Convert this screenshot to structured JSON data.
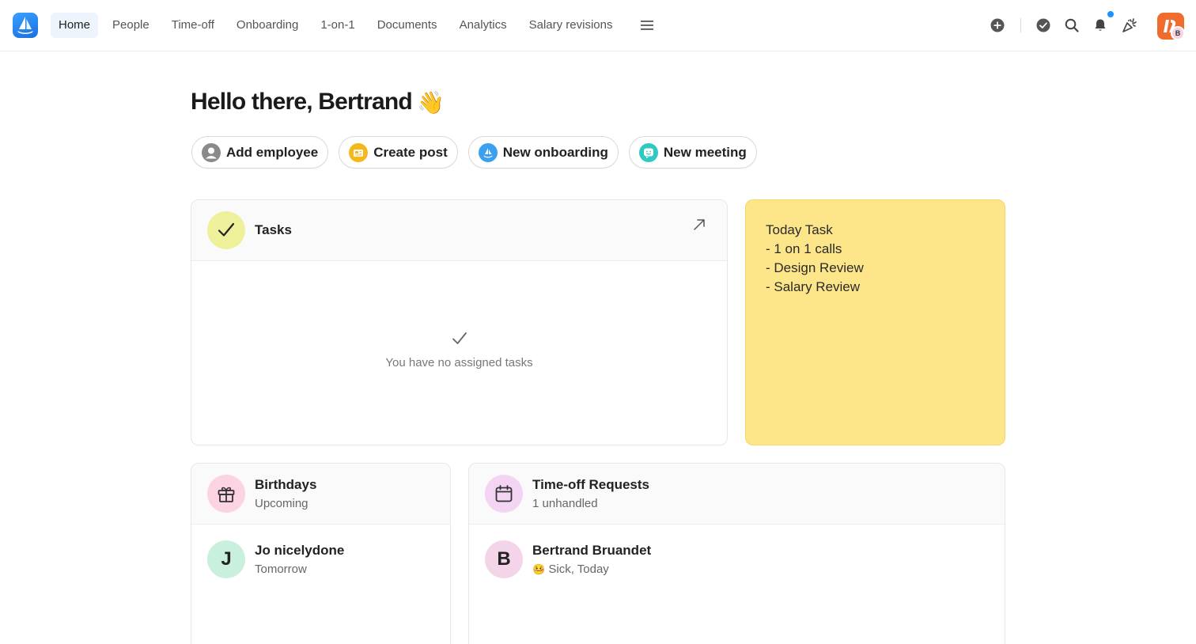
{
  "nav": {
    "items": [
      {
        "label": "Home",
        "active": true
      },
      {
        "label": "People"
      },
      {
        "label": "Time-off"
      },
      {
        "label": "Onboarding"
      },
      {
        "label": "1-on-1"
      },
      {
        "label": "Documents"
      },
      {
        "label": "Analytics"
      },
      {
        "label": "Salary revisions"
      }
    ],
    "menu_icon": "hamburger-menu-icon"
  },
  "toolbar": {
    "icons": [
      "add-circle-icon",
      "check-circle-icon",
      "search-icon",
      "bell-icon",
      "confetti-icon"
    ],
    "user_initial": "B",
    "accent": "#1e90ff"
  },
  "greeting": {
    "text": "Hello there, Bertrand",
    "emoji": "👋"
  },
  "actions": [
    {
      "label": "Add employee",
      "icon": "person-icon",
      "color": "#8a8a8a"
    },
    {
      "label": "Create post",
      "icon": "post-icon",
      "color": "#f5b71a"
    },
    {
      "label": "New onboarding",
      "icon": "onboarding-icon",
      "color": "#3aa0f0"
    },
    {
      "label": "New meeting",
      "icon": "meeting-icon",
      "color": "#2ec9c0"
    }
  ],
  "tasks": {
    "title": "Tasks",
    "empty_text": "You have no assigned tasks",
    "circle_color": "#eef09a"
  },
  "note": {
    "lines": [
      "Today Task",
      "- 1 on 1 calls",
      "- Design Review",
      "- Salary Review"
    ],
    "background": "#fde68a"
  },
  "birthdays": {
    "title": "Birthdays",
    "subtitle": "Upcoming",
    "circle_color": "#fbd3e3",
    "items": [
      {
        "initial": "J",
        "name": "Jo nicelydone",
        "when": "Tomorrow",
        "avatar_color": "#c9f0dc"
      }
    ]
  },
  "timeoff": {
    "title": "Time-off Requests",
    "subtitle": "1 unhandled",
    "circle_color": "#f3d4f3",
    "items": [
      {
        "initial": "B",
        "name": "Bertrand Bruandet",
        "emoji": "🤒",
        "detail": "Sick, Today",
        "avatar_color": "#f3d4e8"
      }
    ]
  }
}
